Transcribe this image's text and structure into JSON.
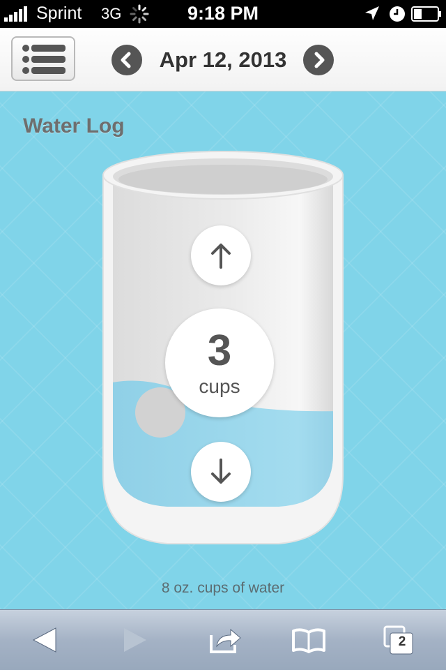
{
  "status_bar": {
    "carrier": "Sprint",
    "network": "3G",
    "time": "9:18 PM",
    "icons": [
      "signal-bars-icon",
      "activity-spinner-icon",
      "location-arrow-icon",
      "clock-icon",
      "battery-icon"
    ]
  },
  "header": {
    "date": "Apr 12, 2013",
    "menu_icon": "list-icon",
    "prev_icon": "chevron-left-icon",
    "next_icon": "chevron-right-icon"
  },
  "water_log": {
    "title": "Water Log",
    "count": "3",
    "unit": "cups",
    "fill_level": 0.3,
    "increase_icon": "arrow-up-icon",
    "decrease_icon": "arrow-down-icon",
    "note": "8 oz. cups of water"
  },
  "toolbar": {
    "tabs_count": "2",
    "icons": [
      "back-arrow-icon",
      "forward-arrow-icon",
      "share-icon",
      "bookmarks-icon",
      "tabs-icon"
    ]
  },
  "colors": {
    "background": "#80d4e9",
    "water": "#8fd3ea",
    "glass": "#e6e6e6",
    "toolbar": "#a4b2c5"
  }
}
